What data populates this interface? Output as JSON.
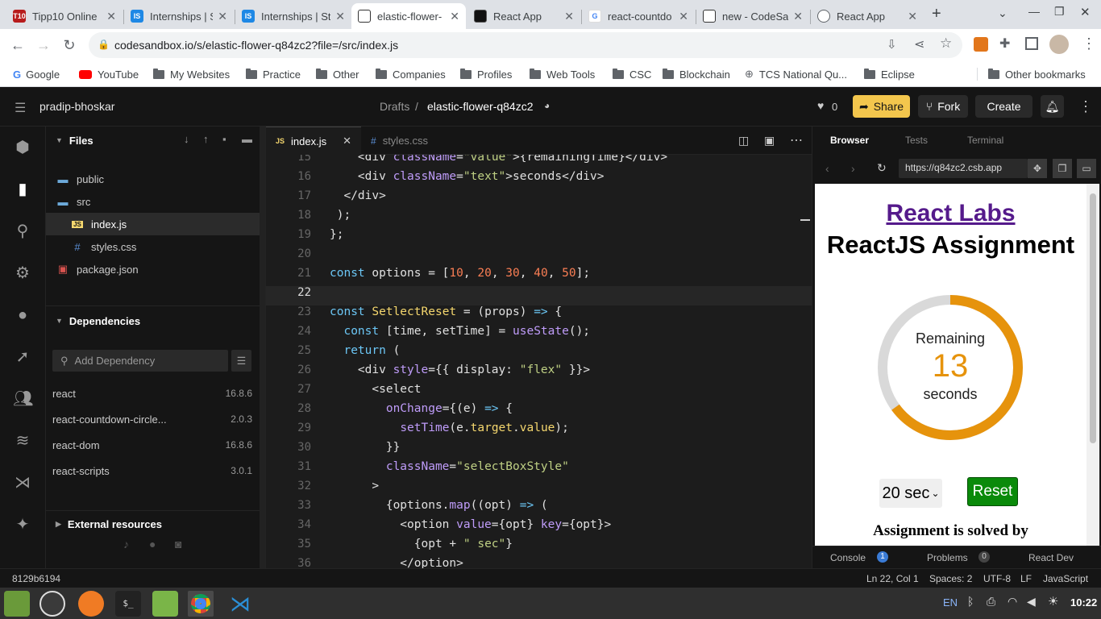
{
  "browser": {
    "tabs": [
      {
        "title": "Tipp10 Online",
        "icon": "T10",
        "color": "#b71c1c"
      },
      {
        "title": "Internships | Sta",
        "icon": "IS",
        "color": "#1e88e5"
      },
      {
        "title": "Internships | Sta",
        "icon": "IS",
        "color": "#1e88e5"
      },
      {
        "title": "elastic-flower-",
        "icon": "",
        "color": "#ffffff"
      },
      {
        "title": "React App",
        "icon": "",
        "color": "#111111"
      },
      {
        "title": "react-countdo",
        "icon": "G",
        "color": "#4285f4"
      },
      {
        "title": "new - CodeSa",
        "icon": "",
        "color": "#ffffff"
      },
      {
        "title": "React App",
        "icon": "",
        "color": "#5f6368"
      }
    ],
    "url": "codesandbox.io/s/elastic-flower-q84zc2?file=/src/index.js",
    "bookmarks": [
      "Google",
      "YouTube",
      "My Websites",
      "Practice",
      "Other",
      "Companies",
      "Profiles",
      "Web Tools",
      "CSC",
      "Blockchain",
      "TCS National Qu...",
      "Eclipse",
      "Other bookmarks"
    ]
  },
  "header": {
    "user": "pradip-bhoskar",
    "breadcrumb_root": "Drafts",
    "sandbox_name": "elastic-flower-q84zc2",
    "likes": "0",
    "share": "Share",
    "fork": "Fork",
    "create": "Create"
  },
  "files": {
    "title": "Files",
    "items": [
      {
        "name": "public",
        "kind": "folder",
        "indent": 0
      },
      {
        "name": "src",
        "kind": "folder",
        "indent": 0
      },
      {
        "name": "index.js",
        "kind": "js",
        "indent": 1
      },
      {
        "name": "styles.css",
        "kind": "css",
        "indent": 1
      },
      {
        "name": "package.json",
        "kind": "json",
        "indent": 0
      }
    ]
  },
  "dependencies": {
    "title": "Dependencies",
    "placeholder": "Add Dependency",
    "items": [
      {
        "name": "react",
        "version": "16.8.6"
      },
      {
        "name": "react-countdown-circle...",
        "version": "2.0.3"
      },
      {
        "name": "react-dom",
        "version": "16.8.6"
      },
      {
        "name": "react-scripts",
        "version": "3.0.1"
      }
    ]
  },
  "external": {
    "title": "External resources"
  },
  "editor": {
    "tabs": [
      "index.js",
      "styles.css"
    ],
    "active_line": 22,
    "lines": [
      {
        "n": 15,
        "html": "    <span class='p'>&lt;</span><span class='t'>div</span> <span class='a'>className</span>=<span class='str'>\"value\"</span>&gt;{remainingTime}&lt;/div&gt;"
      },
      {
        "n": 16,
        "html": "    &lt;div <span class='a'>className</span>=<span class='str'>\"text\"</span>&gt;seconds&lt;/div&gt;"
      },
      {
        "n": 17,
        "html": "  &lt;/div&gt;"
      },
      {
        "n": 18,
        "html": " );"
      },
      {
        "n": 19,
        "html": "};"
      },
      {
        "n": 20,
        "html": ""
      },
      {
        "n": 21,
        "html": "<span class='k'>const</span> options = [<span class='n'>10</span>, <span class='n'>20</span>, <span class='n'>30</span>, <span class='n'>40</span>, <span class='n'>50</span>];"
      },
      {
        "n": 22,
        "html": ""
      },
      {
        "n": 23,
        "html": "<span class='k'>const</span> <span class='c'>SetlectReset</span> = (props) <span class='k'>=&gt;</span> {"
      },
      {
        "n": 24,
        "html": "  <span class='k'>const</span> [time, setTime] = <span class='f'>useState</span>();"
      },
      {
        "n": 25,
        "html": "  <span class='k'>return</span> ("
      },
      {
        "n": 26,
        "html": "    &lt;div <span class='a'>style</span>={{ display: <span class='str'>\"flex\"</span> }}&gt;"
      },
      {
        "n": 27,
        "html": "      &lt;select"
      },
      {
        "n": 28,
        "html": "        <span class='a'>onChange</span>={(e) <span class='k'>=&gt;</span> {"
      },
      {
        "n": 29,
        "html": "          <span class='f'>setTime</span>(e.<span class='c'>target</span>.<span class='c'>value</span>);"
      },
      {
        "n": 30,
        "html": "        }}"
      },
      {
        "n": 31,
        "html": "        <span class='a'>className</span>=<span class='str'>\"selectBoxStyle\"</span>"
      },
      {
        "n": 32,
        "html": "      &gt;"
      },
      {
        "n": 33,
        "html": "        {options.<span class='f'>map</span>((opt) <span class='k'>=&gt;</span> ("
      },
      {
        "n": 34,
        "html": "          &lt;option <span class='a'>value</span>={opt} <span class='a'>key</span>={opt}&gt;"
      },
      {
        "n": 35,
        "html": "            {opt + <span class='str'>\" sec\"</span>}"
      },
      {
        "n": 36,
        "html": "          &lt;/option&gt;"
      }
    ]
  },
  "preview": {
    "tabs": [
      "Browser",
      "Tests",
      "Terminal"
    ],
    "url": "https://q84zc2.csb.app",
    "link": "React Labs",
    "heading": "ReactJS Assignment",
    "remaining": "Remaining",
    "value": "13",
    "seconds": "seconds",
    "progress": 0.65,
    "select_value": "20 sec",
    "reset": "Reset",
    "footer": "Assignment is solved by",
    "bottom_tabs": [
      "Console",
      "Problems",
      "React Dev"
    ],
    "console_count": "1",
    "problems_count": "0"
  },
  "status": {
    "commit": "8129b6194",
    "position": "Ln 22, Col 1",
    "spaces": "Spaces: 2",
    "encoding": "UTF-8",
    "eol": "LF",
    "language": "JavaScript"
  },
  "taskbar": {
    "lang": "EN",
    "time": "10:22"
  },
  "colors": {
    "accent": "#e6930c",
    "share": "#f3c64d",
    "reset": "#0a8a0a"
  }
}
